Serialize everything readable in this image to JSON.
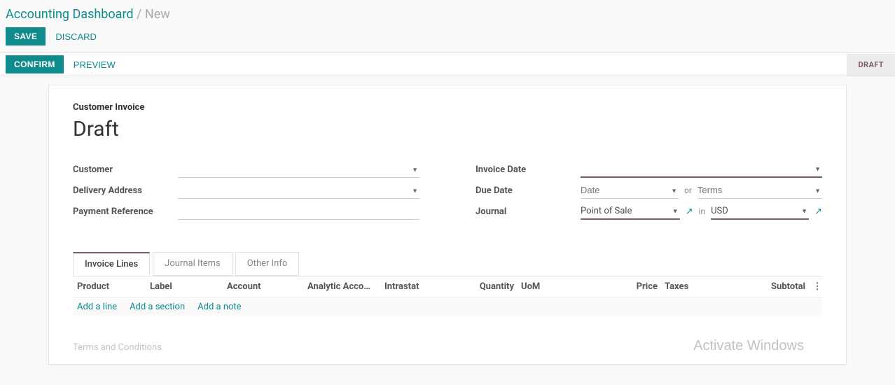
{
  "breadcrumb": {
    "root": "Accounting Dashboard",
    "current": "New",
    "sep": " / "
  },
  "actions": {
    "save": "SAVE",
    "discard": "DISCARD"
  },
  "statusbar": {
    "confirm": "CONFIRM",
    "preview": "PREVIEW",
    "state": "DRAFT"
  },
  "doc": {
    "type": "Customer Invoice",
    "title": "Draft"
  },
  "labels": {
    "customer": "Customer",
    "delivery_address": "Delivery Address",
    "payment_reference": "Payment Reference",
    "invoice_date": "Invoice Date",
    "due_date": "Due Date",
    "journal": "Journal",
    "or": "or",
    "in": "in"
  },
  "fields": {
    "customer": "",
    "delivery_address": "",
    "payment_reference": "",
    "invoice_date": "",
    "due_date_placeholder": "Date",
    "terms_placeholder": "Terms",
    "journal": "Point of Sale",
    "currency": "USD"
  },
  "tabs": {
    "lines": "Invoice Lines",
    "journal_items": "Journal Items",
    "other": "Other Info"
  },
  "columns": {
    "product": "Product",
    "label": "Label",
    "account": "Account",
    "analytic": "Analytic Acco…",
    "intrastat": "Intrastat",
    "quantity": "Quantity",
    "uom": "UoM",
    "price": "Price",
    "taxes": "Taxes",
    "subtotal": "Subtotal"
  },
  "add": {
    "line": "Add a line",
    "section": "Add a section",
    "note": "Add a note"
  },
  "terms_placeholder": "Terms and Conditions",
  "watermark": "Activate Windows",
  "icons": {
    "kebab": "⋮"
  }
}
